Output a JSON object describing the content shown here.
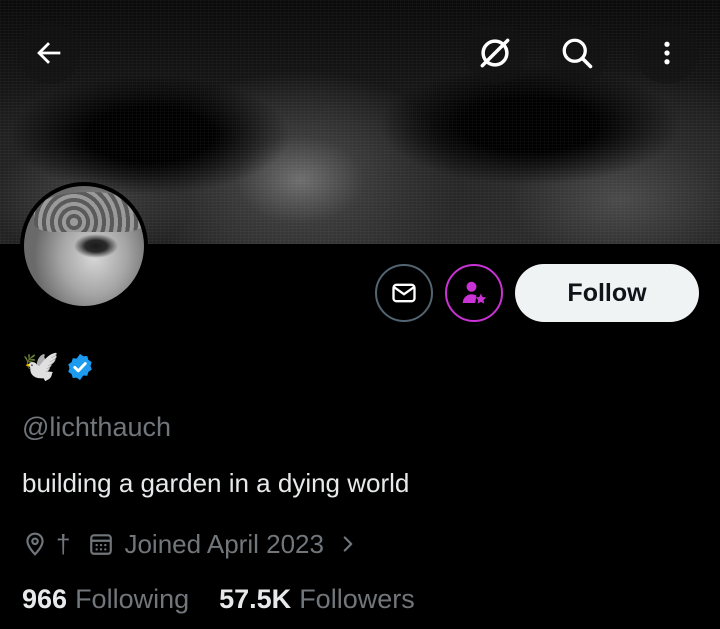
{
  "header": {
    "back_icon": "arrow-left-icon",
    "grok_icon": "grok-slash-icon",
    "search_icon": "search-icon",
    "more_icon": "more-vertical-icon"
  },
  "profile": {
    "display_name_emoji": "🕊️",
    "verified": true,
    "handle": "@lichthauch",
    "bio": "building a garden in a dying world",
    "location": "†",
    "joined": "Joined April 2023",
    "following_count": "966",
    "following_label": "Following",
    "followers_count": "57.5K",
    "followers_label": "Followers"
  },
  "actions": {
    "message_icon": "envelope-icon",
    "subscribe_icon": "subscribe-star-icon",
    "follow_label": "Follow"
  },
  "colors": {
    "background": "#000000",
    "text_primary": "#e7e9ea",
    "text_secondary": "#71767b",
    "verified_blue": "#1d9bf0",
    "subscribe_magenta": "#c932d4",
    "follow_bg": "#eff3f4"
  }
}
